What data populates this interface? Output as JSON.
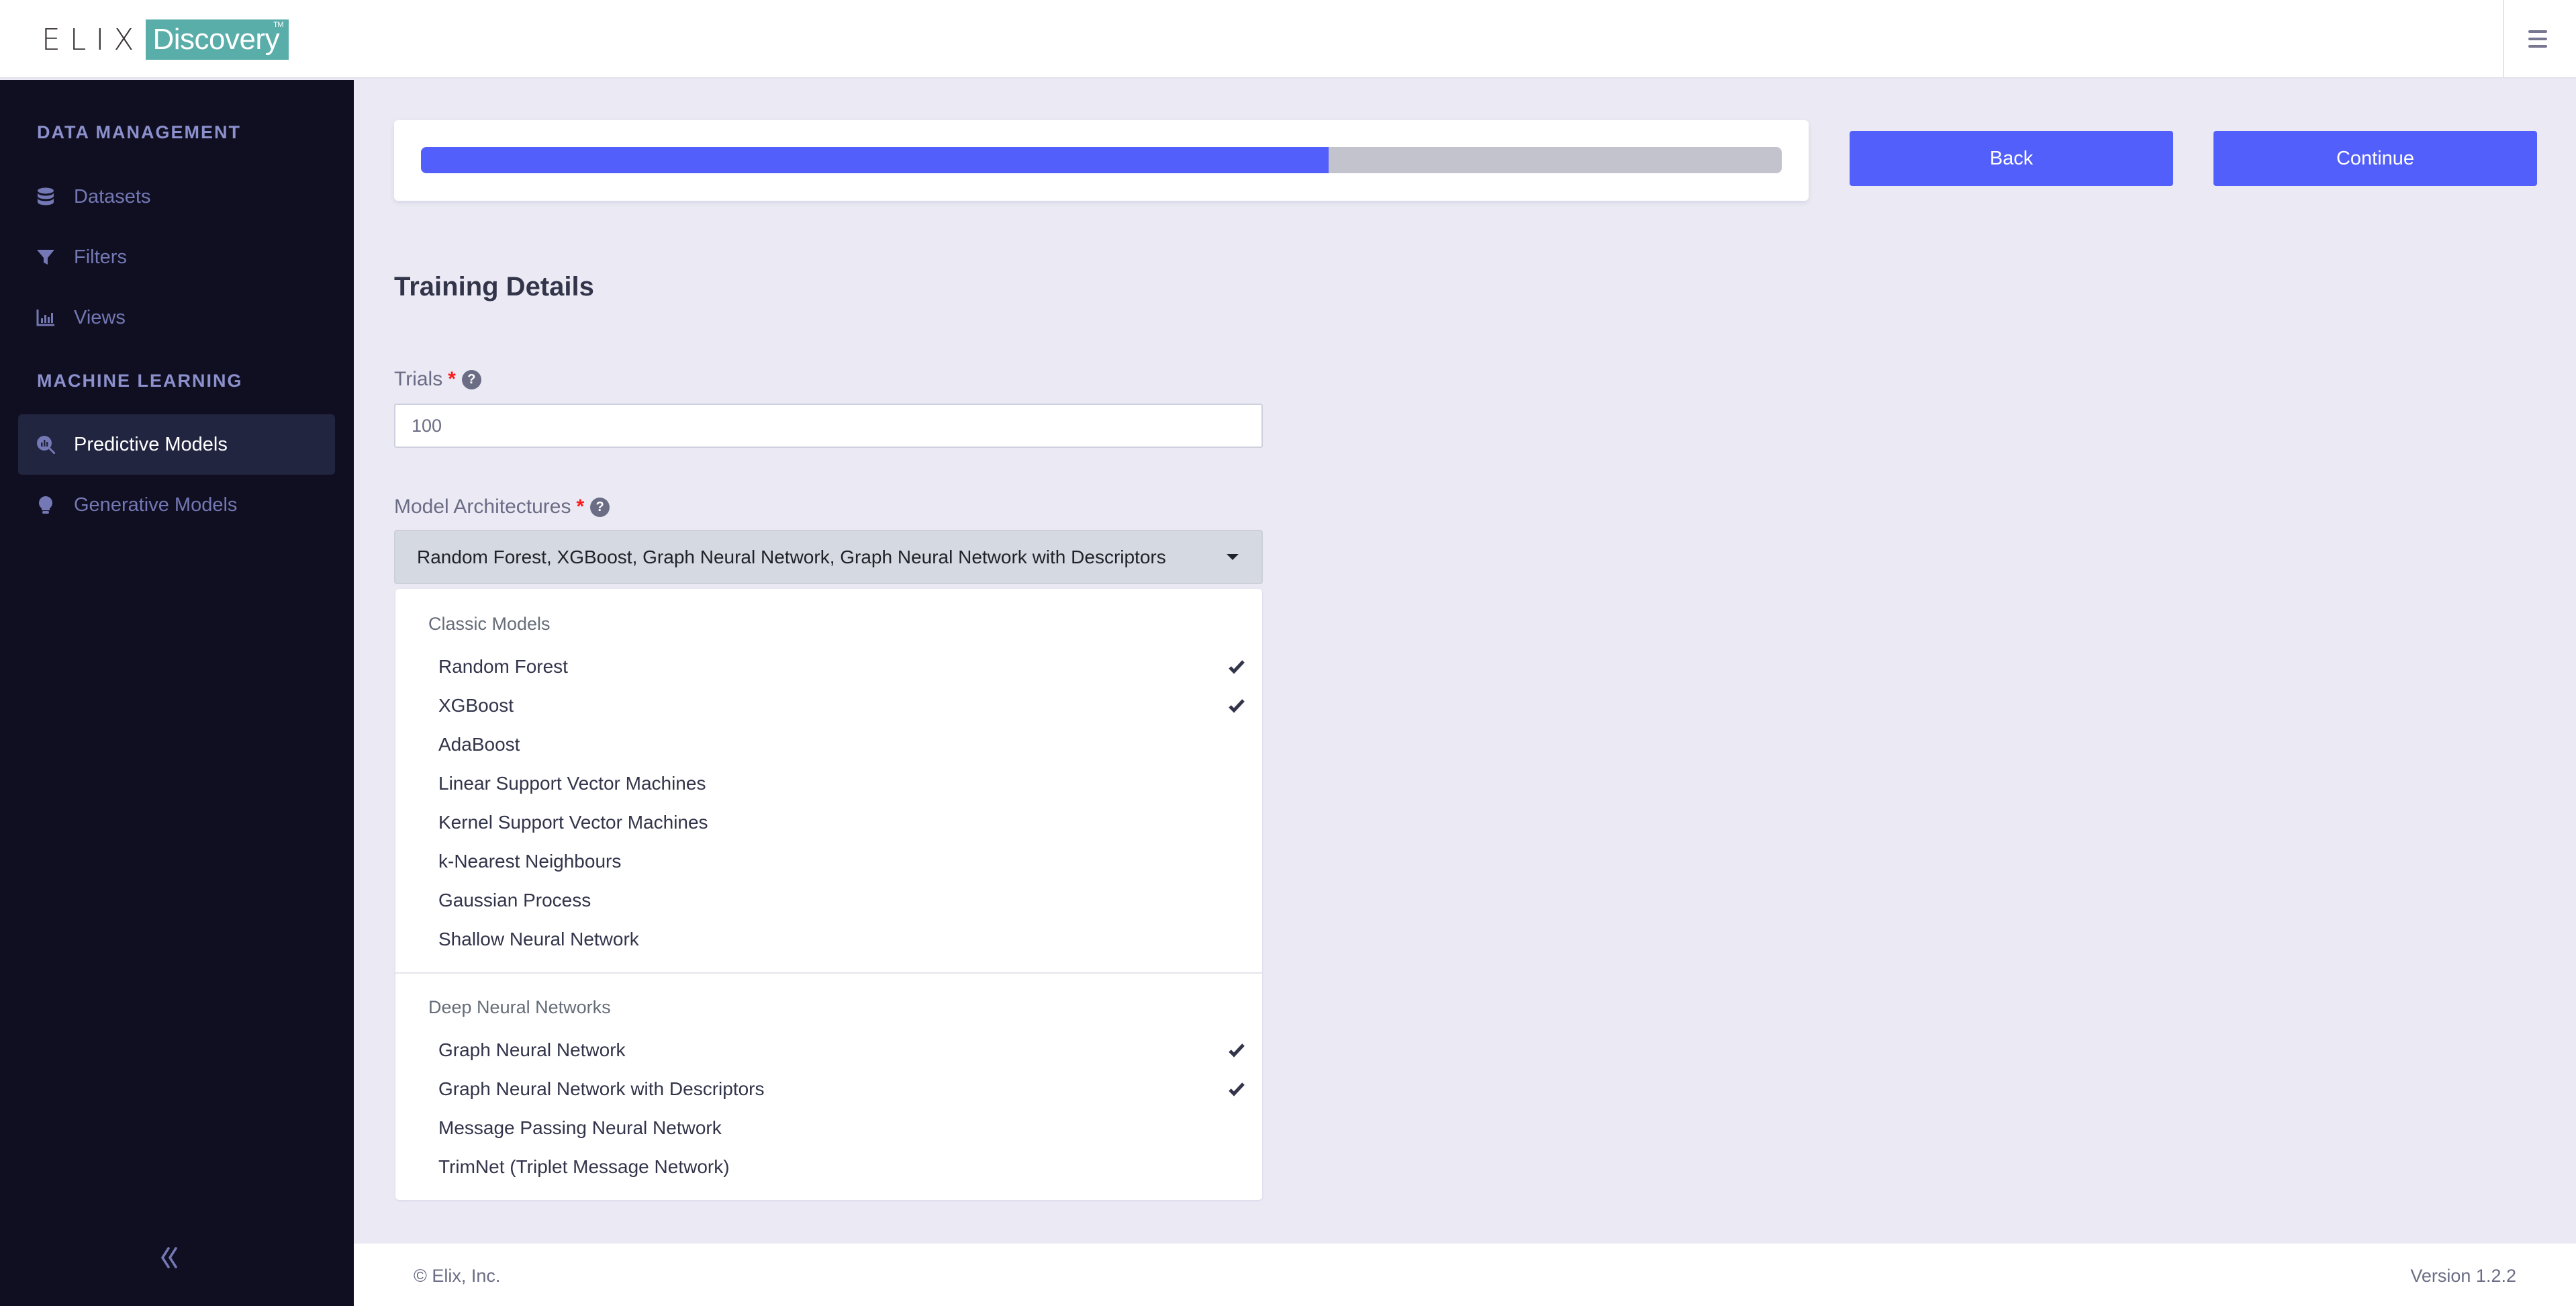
{
  "app": {
    "logo_left": "ELIX",
    "logo_right": "Discovery",
    "logo_tm": "TM"
  },
  "header": {
    "menu_icon": "hamburger-menu-icon"
  },
  "sidebar": {
    "sections": [
      {
        "title": "DATA MANAGEMENT",
        "items": [
          {
            "label": "Datasets",
            "icon": "database-icon",
            "active": false
          },
          {
            "label": "Filters",
            "icon": "filter-icon",
            "active": false
          },
          {
            "label": "Views",
            "icon": "bar-chart-icon",
            "active": false
          }
        ]
      },
      {
        "title": "MACHINE LEARNING",
        "items": [
          {
            "label": "Predictive Models",
            "icon": "search-chart-icon",
            "active": true
          },
          {
            "label": "Generative Models",
            "icon": "lightbulb-icon",
            "active": false
          }
        ]
      }
    ],
    "collapse_icon": "double-chevron-left-icon"
  },
  "wizard": {
    "progress_percent": 66.7,
    "back_label": "Back",
    "continue_label": "Continue"
  },
  "form": {
    "title": "Training Details",
    "trials": {
      "label": "Trials",
      "required_marker": "*",
      "help": "?",
      "value": "100"
    },
    "model_architectures": {
      "label": "Model Architectures",
      "required_marker": "*",
      "help": "?",
      "selected_text": "Random Forest, XGBoost, Graph Neural Network, Graph Neural Network with Descriptors",
      "groups": [
        {
          "label": "Classic Models",
          "options": [
            {
              "label": "Random Forest",
              "selected": true
            },
            {
              "label": "XGBoost",
              "selected": true
            },
            {
              "label": "AdaBoost",
              "selected": false
            },
            {
              "label": "Linear Support Vector Machines",
              "selected": false
            },
            {
              "label": "Kernel Support Vector Machines",
              "selected": false
            },
            {
              "label": "k-Nearest Neighbours",
              "selected": false
            },
            {
              "label": "Gaussian Process",
              "selected": false
            },
            {
              "label": "Shallow Neural Network",
              "selected": false
            }
          ]
        },
        {
          "label": "Deep Neural Networks",
          "options": [
            {
              "label": "Graph Neural Network",
              "selected": true
            },
            {
              "label": "Graph Neural Network with Descriptors",
              "selected": true
            },
            {
              "label": "Message Passing Neural Network",
              "selected": false
            },
            {
              "label": "TrimNet (Triplet Message Network)",
              "selected": false
            }
          ]
        }
      ]
    }
  },
  "footer": {
    "copyright": "© Elix, Inc.",
    "version": "Version 1.2.2"
  },
  "colors": {
    "accent": "#535ffa",
    "sidebar_bg": "#100f22",
    "sidebar_active_bg": "#222540",
    "logo_teal": "#5aaeaa",
    "page_bg": "#ebeaf4",
    "required": "#ff1a1a"
  }
}
